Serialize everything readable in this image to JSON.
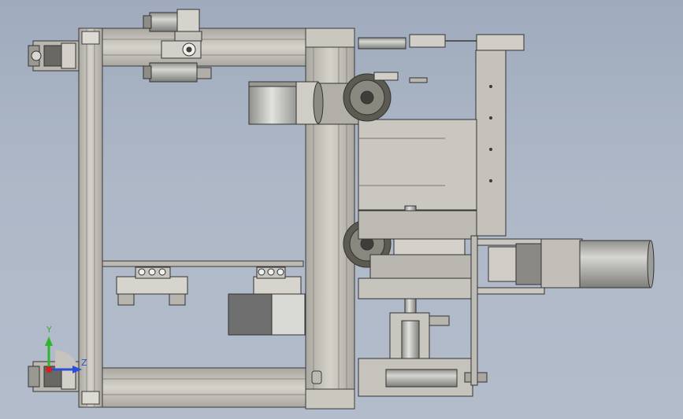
{
  "view": {
    "type": "cad-assembly-front-view",
    "background_top": "#9fabbd",
    "background_bottom": "#b3bccb"
  },
  "colors": {
    "frame": "#c6c4bb",
    "frame_edge": "#3a3a3a",
    "frame_groove": "#8e8d87",
    "metal_light": "#d8d8d2",
    "metal_dark": "#7a7a76",
    "motor_body": "#b7b5ae",
    "motor_gray": "#a3a3a0",
    "box_dark": "#6f6f6f",
    "box_light": "#d9d9d6",
    "gear": "#5d5a52",
    "axis_y": "#2fb52f",
    "axis_z": "#2b4fd8",
    "axis_x": "#d42020"
  },
  "triad": {
    "y_label": "Y",
    "z_label": "Z"
  }
}
